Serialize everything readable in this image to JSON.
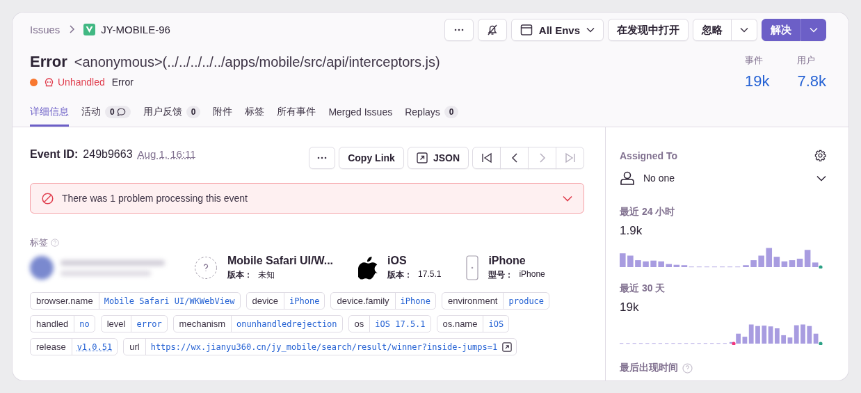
{
  "breadcrumb": {
    "parent": "Issues",
    "current": "JY-MOBILE-96"
  },
  "toolbar": {
    "env": "All Envs",
    "open_in_discover": "在发现中打开",
    "ignore": "忽略",
    "resolve": "解决"
  },
  "title": {
    "type": "Error",
    "culprit": "<anonymous>(../../../../../apps/mobile/src/api/interceptors.js)"
  },
  "subtitle": {
    "status": "Unhandled",
    "level": "Error"
  },
  "stats": [
    {
      "label": "事件",
      "value": "19k"
    },
    {
      "label": "用户",
      "value": "7.8k"
    }
  ],
  "tabs": [
    {
      "label": "详细信息",
      "selected": true
    },
    {
      "label": "活动",
      "badge": "0",
      "comment_icon": true,
      "selected": false
    },
    {
      "label": "用户反馈",
      "badge": "0",
      "selected": false
    },
    {
      "label": "附件",
      "selected": false
    },
    {
      "label": "标签",
      "selected": false
    },
    {
      "label": "所有事件",
      "selected": false
    },
    {
      "label": "Merged Issues",
      "selected": false
    },
    {
      "label": "Replays",
      "badge": "0",
      "selected": false
    }
  ],
  "event": {
    "label": "Event ID:",
    "id": "249b9663",
    "date": "Aug 1, 16:11",
    "copy_link": "Copy Link",
    "json": "JSON"
  },
  "alert": {
    "message": "There was 1 problem processing this event"
  },
  "tags_heading": "标签",
  "context": [
    {
      "kind": "user"
    },
    {
      "kind": "browser",
      "name": "Mobile Safari UI/W...",
      "meta_label": "版本：",
      "meta_value": "未知"
    },
    {
      "kind": "os",
      "name": "iOS",
      "meta_label": "版本：",
      "meta_value": "17.5.1"
    },
    {
      "kind": "device",
      "name": "iPhone",
      "meta_label": "型号：",
      "meta_value": "iPhone"
    }
  ],
  "tags": [
    {
      "kind": "plain",
      "key": "browser.name",
      "value": "Mobile Safari UI/WKWebView"
    },
    {
      "kind": "plain",
      "key": "device",
      "value": "iPhone"
    },
    {
      "kind": "plain",
      "key": "device.family",
      "value": "iPhone"
    },
    {
      "kind": "plain",
      "key": "environment",
      "value": "produce"
    },
    {
      "kind": "plain",
      "key": "handled",
      "value": "no"
    },
    {
      "kind": "plain",
      "key": "level",
      "value": "error"
    },
    {
      "kind": "plain",
      "key": "mechanism",
      "value": "onunhandledrejection"
    },
    {
      "kind": "plain",
      "key": "os",
      "value": "iOS 17.5.1"
    },
    {
      "kind": "plain",
      "key": "os.name",
      "value": "iOS"
    },
    {
      "kind": "release",
      "key": "release",
      "value": "v1.0.51"
    },
    {
      "kind": "url",
      "key": "url",
      "value": "https://wx.jianyu360.cn/jy_mobile/search/result/winner?inside-jumps=1"
    }
  ],
  "sidebar": {
    "assigned_label": "Assigned To",
    "assignee": "No one",
    "periods": [
      {
        "label": "最近 24 小时",
        "value": "1.9k"
      },
      {
        "label": "最近 30 天",
        "value": "19k"
      }
    ],
    "last_seen_label": "最后出现时间"
  }
}
